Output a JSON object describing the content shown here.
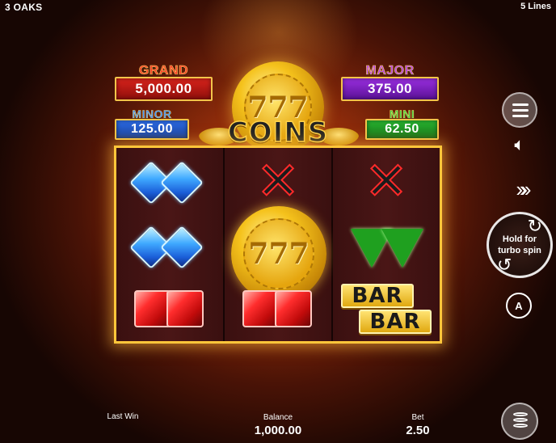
{
  "game": {
    "title": "3 OAKS",
    "lines": "5 Lines"
  },
  "jackpots": {
    "grand": {
      "name": "GRAND",
      "value": "5,000.00",
      "color": "#d9231c"
    },
    "major": {
      "name": "MAJOR",
      "value": "375.00",
      "color": "#9a2ee0"
    },
    "minor": {
      "name": "MINOR",
      "value": "125.00",
      "color": "#2e6ee8"
    },
    "mini": {
      "name": "MINI",
      "value": "62.50",
      "color": "#2ab832"
    }
  },
  "logo": {
    "text": "COINS",
    "coin_label": "777"
  },
  "reels": [
    [
      "blue-diamond",
      "blue-diamond",
      "red-ruby"
    ],
    [
      "x-symbol",
      "coin-777",
      "red-ruby"
    ],
    [
      "x-symbol",
      "green-emerald",
      "bar-bar"
    ]
  ],
  "symbols": {
    "coin_label": "777",
    "bar_top": "BAR",
    "bar_bottom": "BAR"
  },
  "controls": {
    "spin_label": "Hold for turbo spin",
    "auto_label": "A"
  },
  "footer": {
    "last_win_label": "Last Win",
    "last_win_value": "",
    "balance_label": "Balance",
    "balance_value": "1,000.00",
    "bet_label": "Bet",
    "bet_value": "2.50"
  },
  "colors": {
    "frame": "#ffc63a",
    "background": "#8a2a0a"
  }
}
